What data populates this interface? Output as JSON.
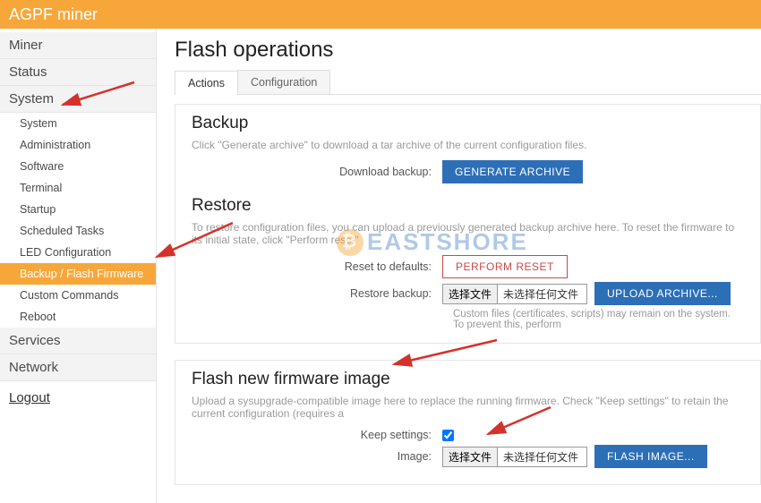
{
  "header": {
    "title": "AGPF miner"
  },
  "sidebar": {
    "items": [
      {
        "label": "Miner",
        "type": "top"
      },
      {
        "label": "Status",
        "type": "top"
      },
      {
        "label": "System",
        "type": "top",
        "open": true
      },
      {
        "label": "System",
        "type": "sub"
      },
      {
        "label": "Administration",
        "type": "sub"
      },
      {
        "label": "Software",
        "type": "sub"
      },
      {
        "label": "Terminal",
        "type": "sub"
      },
      {
        "label": "Startup",
        "type": "sub"
      },
      {
        "label": "Scheduled Tasks",
        "type": "sub"
      },
      {
        "label": "LED Configuration",
        "type": "sub"
      },
      {
        "label": "Backup / Flash Firmware",
        "type": "sub",
        "active": true
      },
      {
        "label": "Custom Commands",
        "type": "sub"
      },
      {
        "label": "Reboot",
        "type": "sub"
      },
      {
        "label": "Services",
        "type": "top"
      },
      {
        "label": "Network",
        "type": "top"
      }
    ],
    "logout": "Logout"
  },
  "page": {
    "title": "Flash operations",
    "tabs": [
      {
        "label": "Actions",
        "active": true
      },
      {
        "label": "Configuration",
        "active": false
      }
    ]
  },
  "backup": {
    "heading": "Backup",
    "desc": "Click \"Generate archive\" to download a tar archive of the current configuration files.",
    "download_label": "Download backup:",
    "generate_btn": "GENERATE ARCHIVE"
  },
  "restore": {
    "heading": "Restore",
    "desc": "To restore configuration files, you can upload a previously generated backup archive here. To reset the firmware to its initial state, click \"Perform reset\"",
    "reset_label": "Reset to defaults:",
    "reset_btn": "PERFORM RESET",
    "restore_label": "Restore backup:",
    "file_btn": "选择文件",
    "file_txt": "未选择任何文件",
    "upload_btn": "UPLOAD ARCHIVE...",
    "note": "Custom files (certificates, scripts) may remain on the system. To prevent this, perform"
  },
  "flash": {
    "heading": "Flash new firmware image",
    "desc": "Upload a sysupgrade-compatible image here to replace the running firmware. Check \"Keep settings\" to retain the current configuration (requires a",
    "keep_label": "Keep settings:",
    "keep_checked": true,
    "image_label": "Image:",
    "file_btn": "选择文件",
    "file_txt": "未选择任何文件",
    "flash_btn": "FLASH IMAGE..."
  },
  "watermark": "EASTSHORE"
}
